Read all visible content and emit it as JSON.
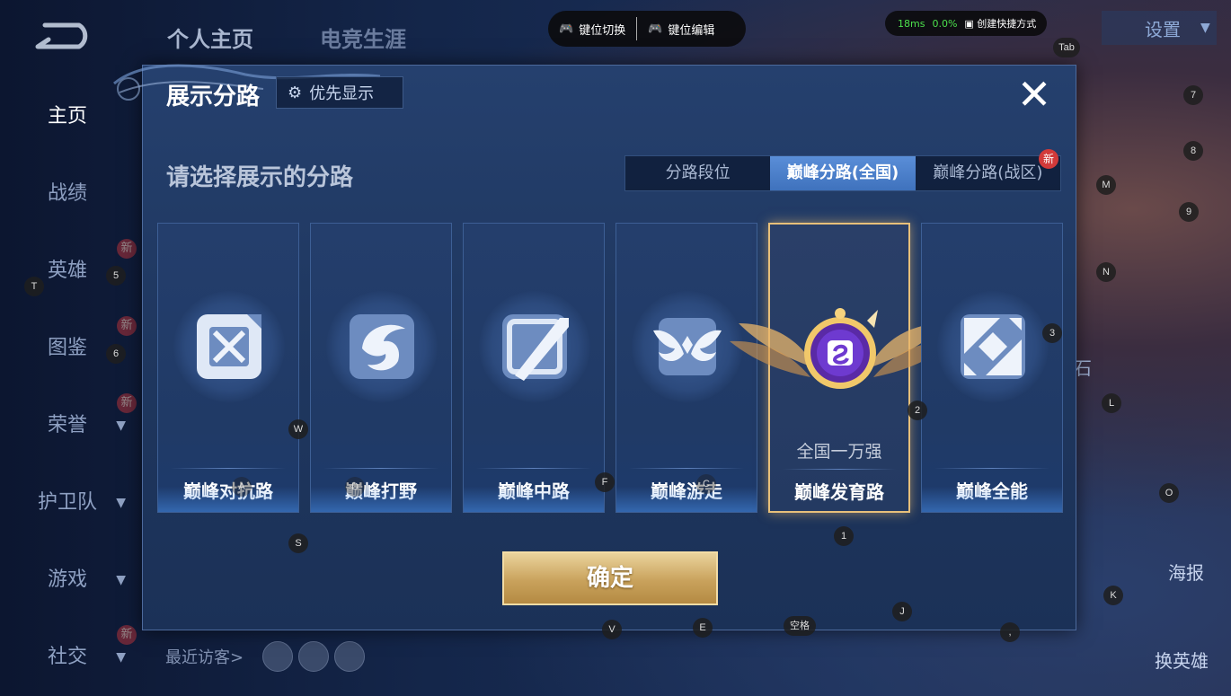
{
  "topnav": {
    "profile": "个人主页",
    "career": "电竞生涯"
  },
  "leftnav": [
    {
      "label": "主页",
      "active": true
    },
    {
      "label": "战绩"
    },
    {
      "label": "英雄",
      "new": "新"
    },
    {
      "label": "图鉴",
      "new": "新"
    },
    {
      "label": "荣誉",
      "new": "新",
      "chevron": true
    },
    {
      "label": "护卫队",
      "chevron": true
    },
    {
      "label": "游戏",
      "chevron": true
    },
    {
      "label": "社交",
      "new": "新",
      "chevron": true
    }
  ],
  "toolbar": {
    "key_switch": "键位切换",
    "key_edit": "键位编辑"
  },
  "status": {
    "ping": "18ms",
    "loss": "0.0%",
    "shortcut": "创建快捷方式"
  },
  "settings": {
    "label": "设置"
  },
  "dialog": {
    "title": "展示分路",
    "priority_btn": "优先显示",
    "close": "✕",
    "subtitle": "请选择展示的分路",
    "tabs": [
      {
        "label": "分路段位"
      },
      {
        "label": "巅峰分路(全国)",
        "active": true
      },
      {
        "label": "巅峰分路(战区)",
        "badge": "新"
      }
    ],
    "cards": [
      {
        "label": "巅峰对抗路",
        "icon": "sword-cross-icon"
      },
      {
        "label": "巅峰打野",
        "icon": "dragon-icon"
      },
      {
        "label": "巅峰中路",
        "icon": "slash-icon"
      },
      {
        "label": "巅峰游走",
        "icon": "wings-icon"
      },
      {
        "label": "巅峰发育路",
        "icon": "marksman-emblem-icon",
        "rank": "全国一万强",
        "selected": true
      },
      {
        "label": "巅峰全能",
        "icon": "allround-icon"
      }
    ],
    "confirm": "确定"
  },
  "visitors": {
    "label": "最近访客>"
  },
  "right_panel": {
    "stone": "铭记之石",
    "poster": "海报",
    "switch_hero": "换英雄"
  },
  "keys": [
    {
      "k": "T"
    },
    {
      "k": "5"
    },
    {
      "k": "6"
    },
    {
      "k": "W"
    },
    {
      "k": "A"
    },
    {
      "k": "D"
    },
    {
      "k": "F"
    },
    {
      "k": "C"
    },
    {
      "k": "S"
    },
    {
      "k": "1"
    },
    {
      "k": "2"
    },
    {
      "k": "3"
    },
    {
      "k": "L"
    },
    {
      "k": "O"
    },
    {
      "k": "K"
    },
    {
      "k": "J"
    },
    {
      "k": ","
    },
    {
      "k": "V"
    },
    {
      "k": "E"
    },
    {
      "k": "空格"
    },
    {
      "k": "Tab"
    },
    {
      "k": "7"
    },
    {
      "k": "8"
    },
    {
      "k": "M"
    },
    {
      "k": "9"
    },
    {
      "k": "N"
    }
  ],
  "colors": {
    "accent_blue": "#3f72bd",
    "gold": "#e8c07a",
    "panel": "#1f375f"
  }
}
